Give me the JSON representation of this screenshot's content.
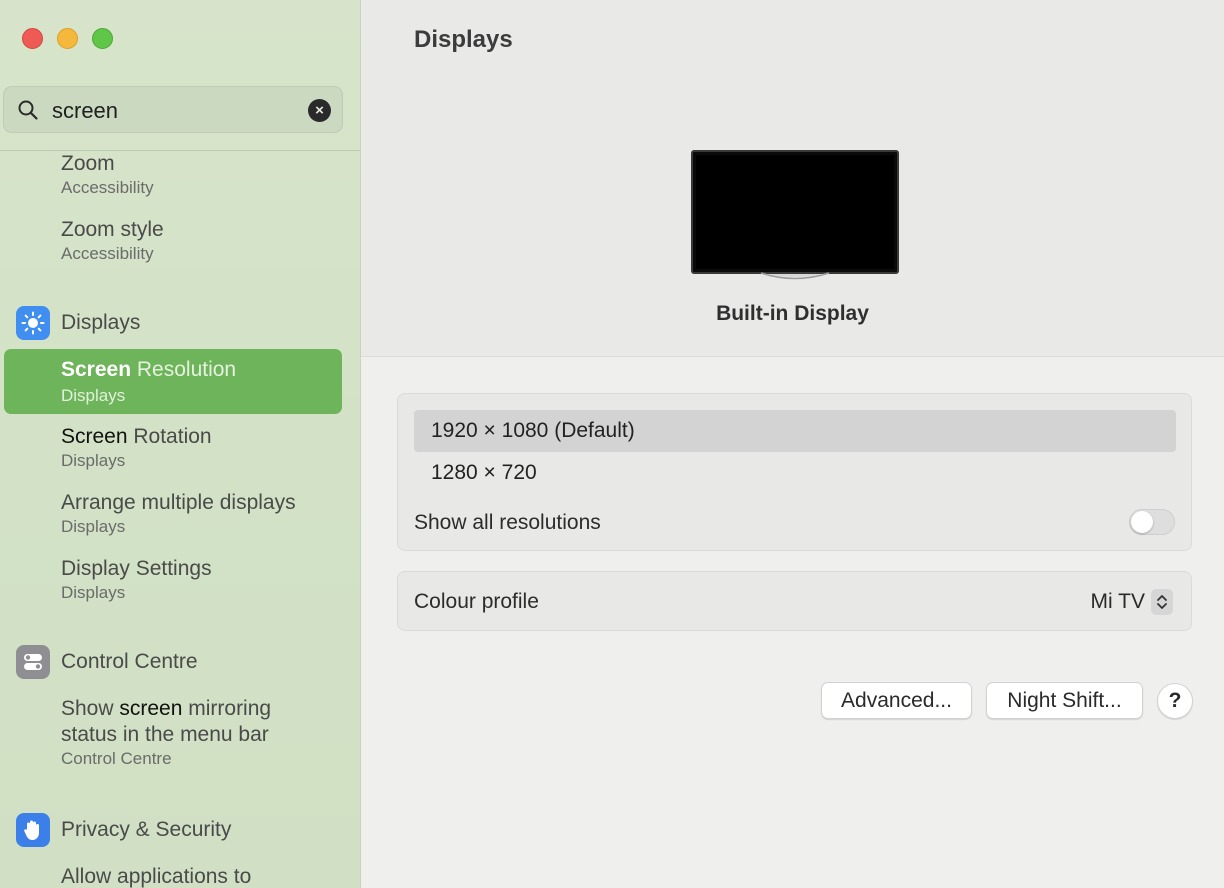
{
  "window": {
    "controls": [
      "close",
      "minimize",
      "zoom"
    ]
  },
  "sidebar": {
    "search": {
      "query": "screen",
      "clear_icon": "×"
    },
    "results": [
      {
        "title": "Zoom",
        "subtitle": "Accessibility"
      },
      {
        "title": "Zoom style",
        "subtitle": "Accessibility"
      },
      {
        "category": "Displays",
        "icon": "sun-icon"
      },
      {
        "title_bold": "Screen",
        "title_rest": " Resolution",
        "subtitle": "Displays",
        "selected": true
      },
      {
        "title_bold": "Screen",
        "title_rest": " Rotation",
        "subtitle": "Displays"
      },
      {
        "title": "Arrange multiple displays",
        "subtitle": "Displays"
      },
      {
        "title": "Display Settings",
        "subtitle": "Displays"
      },
      {
        "category": "Control Centre",
        "icon": "control-centre-icon"
      },
      {
        "title_pre": "Show ",
        "title_bold": "screen",
        "title_rest": " mirroring",
        "title_line2": "status in the menu bar",
        "subtitle": "Control Centre"
      },
      {
        "category": "Privacy & Security",
        "icon": "hand-icon"
      },
      {
        "title": "Allow applications to"
      }
    ]
  },
  "main": {
    "title": "Displays",
    "display_name": "Built-in Display",
    "resolutions": [
      {
        "label": "1920 × 1080 (Default)",
        "selected": true
      },
      {
        "label": "1280 × 720",
        "selected": false
      }
    ],
    "show_all_resolutions": {
      "label": "Show all resolutions",
      "on": false
    },
    "colour_profile": {
      "label": "Colour profile",
      "value": "Mi TV"
    },
    "buttons": {
      "advanced": "Advanced...",
      "night_shift": "Night Shift...",
      "help": "?"
    }
  },
  "colors": {
    "sidebar_bg": "#d5e3c8",
    "selection": "#6eb45a",
    "displays_icon": "#3f8ef0",
    "control_centre_icon": "#8e8e93",
    "privacy_icon": "#3d7fe8"
  }
}
